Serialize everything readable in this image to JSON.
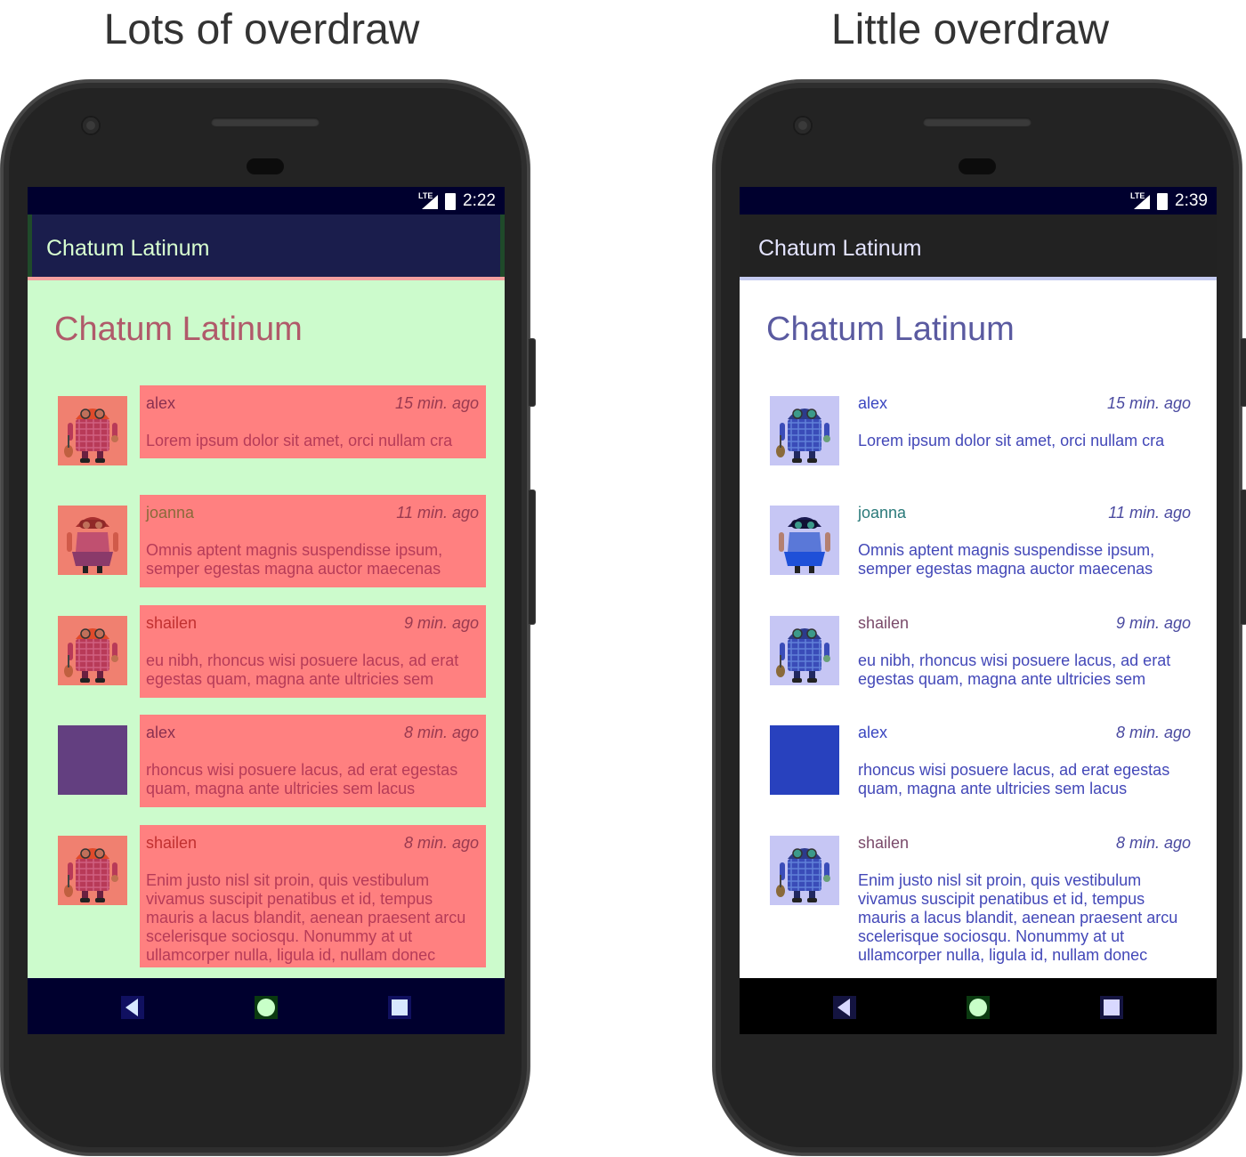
{
  "left": {
    "heading": "Lots of overdraw",
    "status_time": "2:22",
    "status_lte": "LTE",
    "app_title": "Chatum Latinum",
    "page_title": "Chatum Latinum",
    "colors": {
      "statusbar": "#00002e",
      "appbar": "#1a1d4c",
      "content": "#ccfbcc",
      "card": "#ff8080",
      "text": "#b63b58",
      "name": "#8a3050",
      "navbar": "#00002e"
    },
    "messages": [
      {
        "name": "alex",
        "time": "15 min. ago",
        "text": "Lorem ipsum dolor sit amet, orci nullam cra",
        "avatar": "android-plaid-icon"
      },
      {
        "name": "joanna",
        "time": "11 min. ago",
        "text": "Omnis aptent magnis suspendisse ipsum, semper egestas magna auctor maecenas",
        "avatar": "android-girl-icon"
      },
      {
        "name": "shailen",
        "time": "9 min. ago",
        "text": "eu nibh, rhoncus wisi posuere lacus, ad erat egestas quam, magna ante ultricies sem",
        "avatar": "android-plaid-icon"
      },
      {
        "name": "alex",
        "time": "8 min. ago",
        "text": "rhoncus wisi posuere lacus, ad erat egestas quam, magna ante ultricies sem lacus",
        "avatar": "solid-square"
      },
      {
        "name": "shailen",
        "time": "8 min. ago",
        "text": "Enim justo nisl sit proin, quis vestibulum vivamus suscipit penatibus et id, tempus mauris a lacus blandit, aenean praesent arcu scelerisque sociosqu. Nonummy at ut ullamcorper nulla, ligula id, nullam donec",
        "avatar": "android-plaid-icon"
      }
    ]
  },
  "right": {
    "heading": "Little overdraw",
    "status_time": "2:39",
    "status_lte": "LTE",
    "app_title": "Chatum Latinum",
    "page_title": "Chatum Latinum",
    "colors": {
      "statusbar": "#00002e",
      "appbar": "#222222",
      "content": "#ffffff",
      "card": "transparent",
      "text": "#4348b8",
      "name": "#3a46c0",
      "navbar": "#000000"
    },
    "messages": [
      {
        "name": "alex",
        "time": "15 min. ago",
        "text": "Lorem ipsum dolor sit amet, orci nullam cra",
        "avatar": "android-plaid-icon"
      },
      {
        "name": "joanna",
        "time": "11 min. ago",
        "text": "Omnis aptent magnis suspendisse ipsum, semper egestas magna auctor maecenas",
        "avatar": "android-girl-icon"
      },
      {
        "name": "shailen",
        "time": "9 min. ago",
        "text": "eu nibh, rhoncus wisi posuere lacus, ad erat egestas quam, magna ante ultricies sem",
        "avatar": "android-plaid-icon"
      },
      {
        "name": "alex",
        "time": "8 min. ago",
        "text": "rhoncus wisi posuere lacus, ad erat egestas quam, magna ante ultricies sem lacus",
        "avatar": "solid-square"
      },
      {
        "name": "shailen",
        "time": "8 min. ago",
        "text": "Enim justo nisl sit proin, quis vestibulum vivamus suscipit penatibus et id, tempus mauris a lacus blandit, aenean praesent arcu scelerisque sociosqu. Nonummy at ut ullamcorper nulla, ligula id, nullam donec",
        "avatar": "android-plaid-icon"
      }
    ]
  },
  "nav_icons": [
    "back-icon",
    "home-icon",
    "recents-icon"
  ]
}
